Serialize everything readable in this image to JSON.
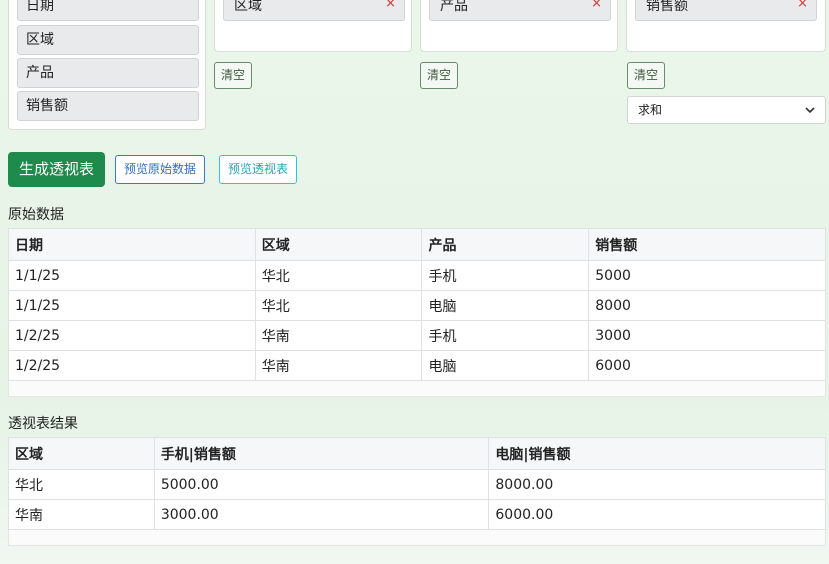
{
  "field_list": [
    "日期",
    "区域",
    "产品",
    "销售额"
  ],
  "zones": {
    "rows": {
      "chip": "区域",
      "remove": "×",
      "clear": "清空"
    },
    "columns": {
      "chip": "产品",
      "remove": "×",
      "clear": "清空"
    },
    "values": {
      "chip": "销售额",
      "remove": "×",
      "clear": "清空",
      "aggregate": "求和"
    }
  },
  "actions": {
    "generate": "生成透视表",
    "preview_raw": "预览原始数据",
    "preview_pivot": "预览透视表"
  },
  "raw": {
    "title": "原始数据",
    "headers": [
      "日期",
      "区域",
      "产品",
      "销售额"
    ],
    "rows": [
      [
        "1/1/25",
        "华北",
        "手机",
        "5000"
      ],
      [
        "1/1/25",
        "华北",
        "电脑",
        "8000"
      ],
      [
        "1/2/25",
        "华南",
        "手机",
        "3000"
      ],
      [
        "1/2/25",
        "华南",
        "电脑",
        "6000"
      ]
    ]
  },
  "pivot": {
    "title": "透视表结果",
    "headers": [
      "区域",
      "手机|销售额",
      "电脑|销售额"
    ],
    "rows": [
      [
        "华北",
        "5000.00",
        "8000.00"
      ],
      [
        "华南",
        "3000.00",
        "6000.00"
      ]
    ]
  }
}
